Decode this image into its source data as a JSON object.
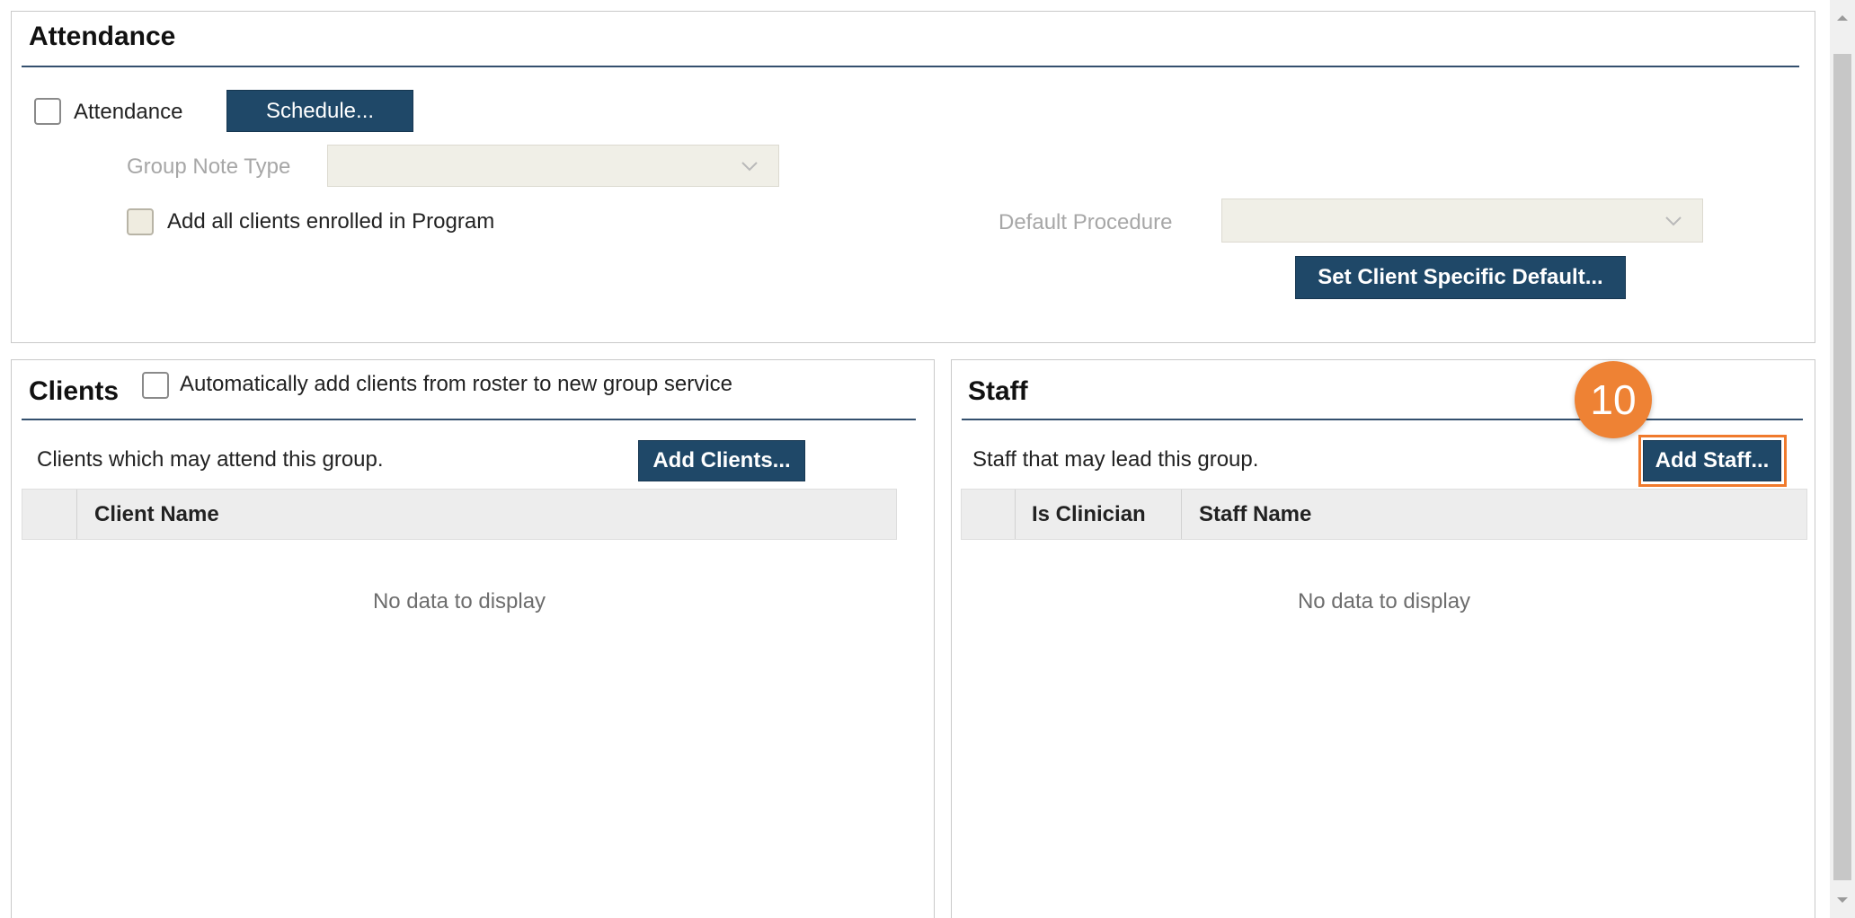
{
  "attendance": {
    "title": "Attendance",
    "checkbox_label": "Attendance",
    "schedule_button": "Schedule...",
    "group_note_type_label": "Group Note Type",
    "group_note_type_value": "",
    "add_all_clients_label": "Add all clients enrolled in Program",
    "default_procedure_label": "Default Procedure",
    "default_procedure_value": "",
    "set_default_button": "Set Client Specific Default..."
  },
  "clients": {
    "title": "Clients",
    "auto_add_label": "Automatically add clients from roster to new group service",
    "description": "Clients which may attend this group.",
    "add_button": "Add Clients...",
    "columns": [
      "Client Name"
    ],
    "empty_text": "No data to display"
  },
  "staff": {
    "title": "Staff",
    "description": "Staff that may lead this group.",
    "add_button": "Add Staff...",
    "columns": [
      "Is Clinician",
      "Staff Name"
    ],
    "empty_text": "No data to display"
  },
  "callout": {
    "step": "10",
    "color": "#ee8234"
  },
  "colors": {
    "button": "#1f4868",
    "rule": "#34506e",
    "highlight": "#f07a2c"
  },
  "icons": {
    "dropdown": "chevron-down-icon",
    "scroll_up": "scroll-up-arrow-icon",
    "scroll_down": "scroll-down-arrow-icon"
  }
}
